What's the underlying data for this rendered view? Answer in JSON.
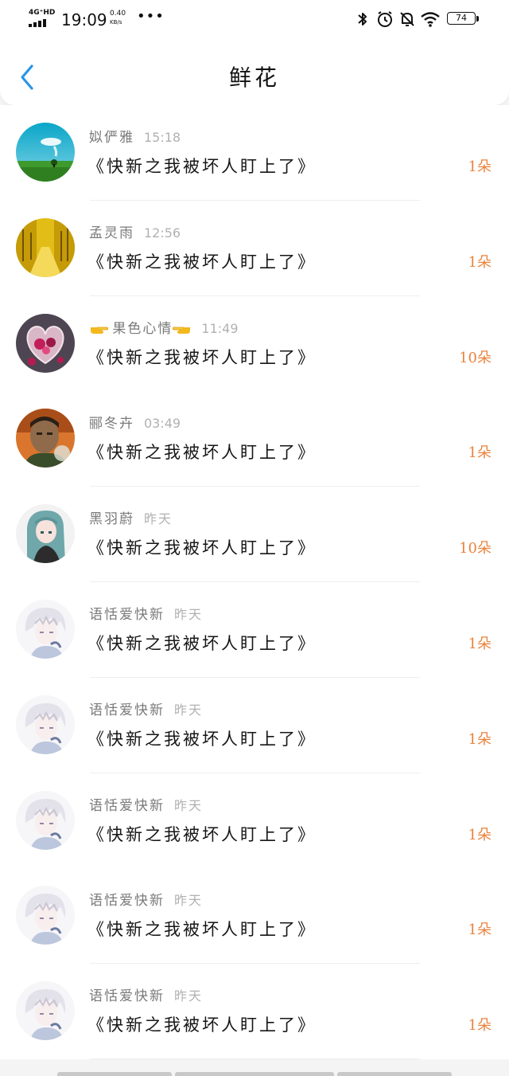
{
  "status_bar": {
    "network": "4G⁺HD",
    "time": "19:09",
    "speed_value": "0.40",
    "speed_unit": "KB/s",
    "more": "•••",
    "battery": "74"
  },
  "header": {
    "back_icon": "chevron-left-icon",
    "title": "鲜花"
  },
  "colors": {
    "accent_blue": "#2a95e8",
    "count_orange": "#e8843e",
    "name_gray": "#7a7a7a",
    "time_gray": "#b1b1b1"
  },
  "rows": [
    {
      "name": "姒俨雅",
      "time": "15:18",
      "book": "《快新之我被坏人盯上了》",
      "count": "1朵",
      "avatar": "landscape-tree"
    },
    {
      "name": "孟灵雨",
      "time": "12:56",
      "book": "《快新之我被坏人盯上了》",
      "count": "1朵",
      "avatar": "ginkgo-road"
    },
    {
      "name": "果色心情",
      "time": "11:49",
      "book": "《快新之我被坏人盯上了》",
      "count": "10朵",
      "avatar": "heart-flowers",
      "emoji": "pointing-hand-emoji"
    },
    {
      "name": "郦冬卉",
      "time": "03:49",
      "book": "《快新之我被坏人盯上了》",
      "count": "1朵",
      "avatar": "game-character"
    },
    {
      "name": "黑羽蔚",
      "time": "昨天",
      "book": "《快新之我被坏人盯上了》",
      "count": "10朵",
      "avatar": "anime-girl"
    },
    {
      "name": "语恬爱快新",
      "time": "昨天",
      "book": "《快新之我被坏人盯上了》",
      "count": "1朵",
      "avatar": "anime-boy"
    },
    {
      "name": "语恬爱快新",
      "time": "昨天",
      "book": "《快新之我被坏人盯上了》",
      "count": "1朵",
      "avatar": "anime-boy"
    },
    {
      "name": "语恬爱快新",
      "time": "昨天",
      "book": "《快新之我被坏人盯上了》",
      "count": "1朵",
      "avatar": "anime-boy"
    },
    {
      "name": "语恬爱快新",
      "time": "昨天",
      "book": "《快新之我被坏人盯上了》",
      "count": "1朵",
      "avatar": "anime-boy"
    },
    {
      "name": "语恬爱快新",
      "time": "昨天",
      "book": "《快新之我被坏人盯上了》",
      "count": "1朵",
      "avatar": "anime-boy"
    }
  ]
}
